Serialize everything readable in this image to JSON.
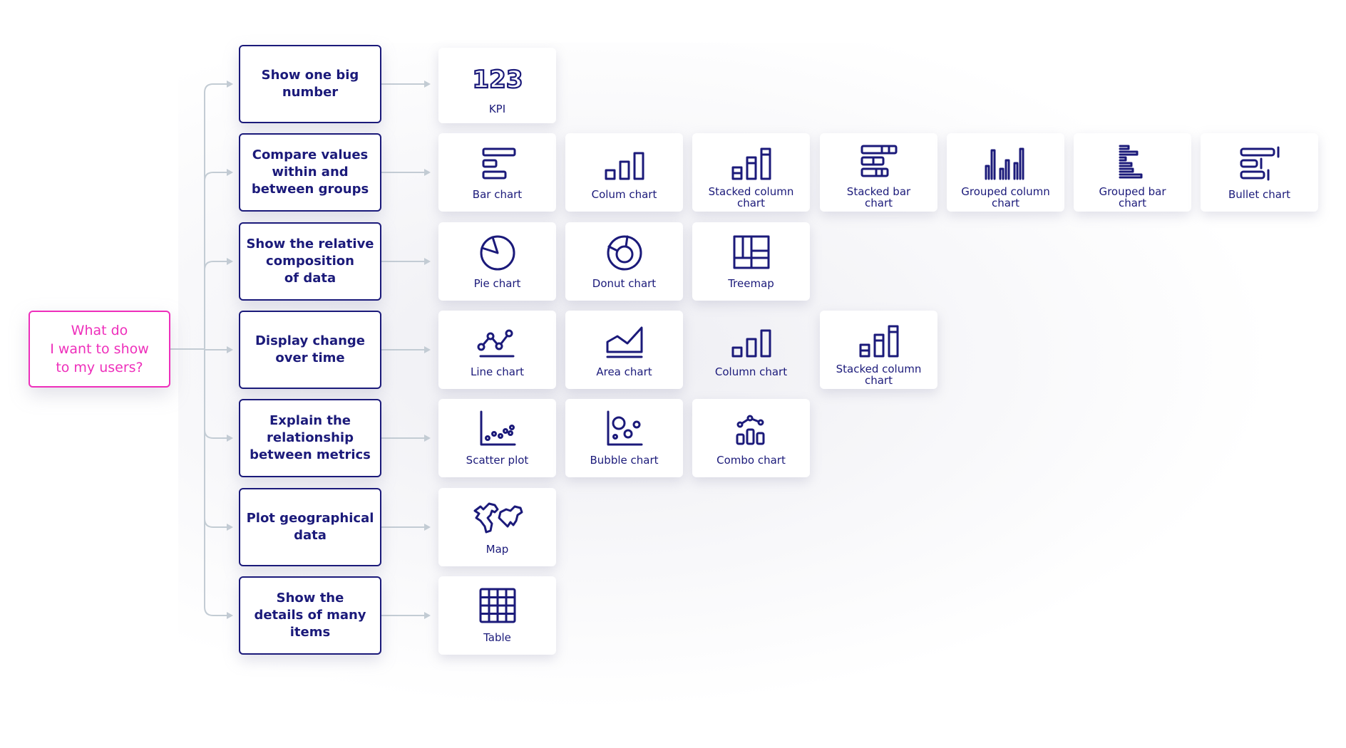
{
  "root": {
    "label": "What do\nI want to show\nto my users?"
  },
  "colors": {
    "accent": "#ee2fbb",
    "navy": "#1b1a7a",
    "connector": "#c3ccd4"
  },
  "rows": [
    {
      "category": "Show one big\nnumber",
      "charts": [
        {
          "label": "KPI",
          "icon": "kpi-123-icon"
        }
      ]
    },
    {
      "category": "Compare values\nwithin and\nbetween groups",
      "charts": [
        {
          "label": "Bar chart",
          "icon": "bar-chart-icon"
        },
        {
          "label": "Colum chart",
          "icon": "column-chart-icon"
        },
        {
          "label": "Stacked column\nchart",
          "icon": "stacked-column-chart-icon"
        },
        {
          "label": "Stacked bar\nchart",
          "icon": "stacked-bar-chart-icon"
        },
        {
          "label": "Grouped column\nchart",
          "icon": "grouped-column-chart-icon"
        },
        {
          "label": "Grouped bar\nchart",
          "icon": "grouped-bar-chart-icon"
        },
        {
          "label": "Bullet chart",
          "icon": "bullet-chart-icon"
        }
      ]
    },
    {
      "category": "Show the relative\ncomposition\nof data",
      "charts": [
        {
          "label": "Pie chart",
          "icon": "pie-chart-icon"
        },
        {
          "label": "Donut chart",
          "icon": "donut-chart-icon"
        },
        {
          "label": "Treemap",
          "icon": "treemap-icon"
        }
      ]
    },
    {
      "category": "Display change\nover time",
      "charts": [
        {
          "label": "Line chart",
          "icon": "line-chart-icon"
        },
        {
          "label": "Area chart",
          "icon": "area-chart-icon"
        },
        {
          "label": "Column chart",
          "icon": "column-chart-icon"
        },
        {
          "label": "Stacked column\nchart",
          "icon": "stacked-column-chart-icon"
        }
      ]
    },
    {
      "category": "Explain the\nrelationship\nbetween metrics",
      "charts": [
        {
          "label": "Scatter plot",
          "icon": "scatter-plot-icon"
        },
        {
          "label": "Bubble chart",
          "icon": "bubble-chart-icon"
        },
        {
          "label": "Combo chart",
          "icon": "combo-chart-icon"
        }
      ]
    },
    {
      "category": "Plot geographical\ndata",
      "charts": [
        {
          "label": "Map",
          "icon": "world-map-icon"
        }
      ]
    },
    {
      "category": "Show the\ndetails of many\nitems",
      "charts": [
        {
          "label": "Table",
          "icon": "table-grid-icon"
        }
      ]
    }
  ]
}
